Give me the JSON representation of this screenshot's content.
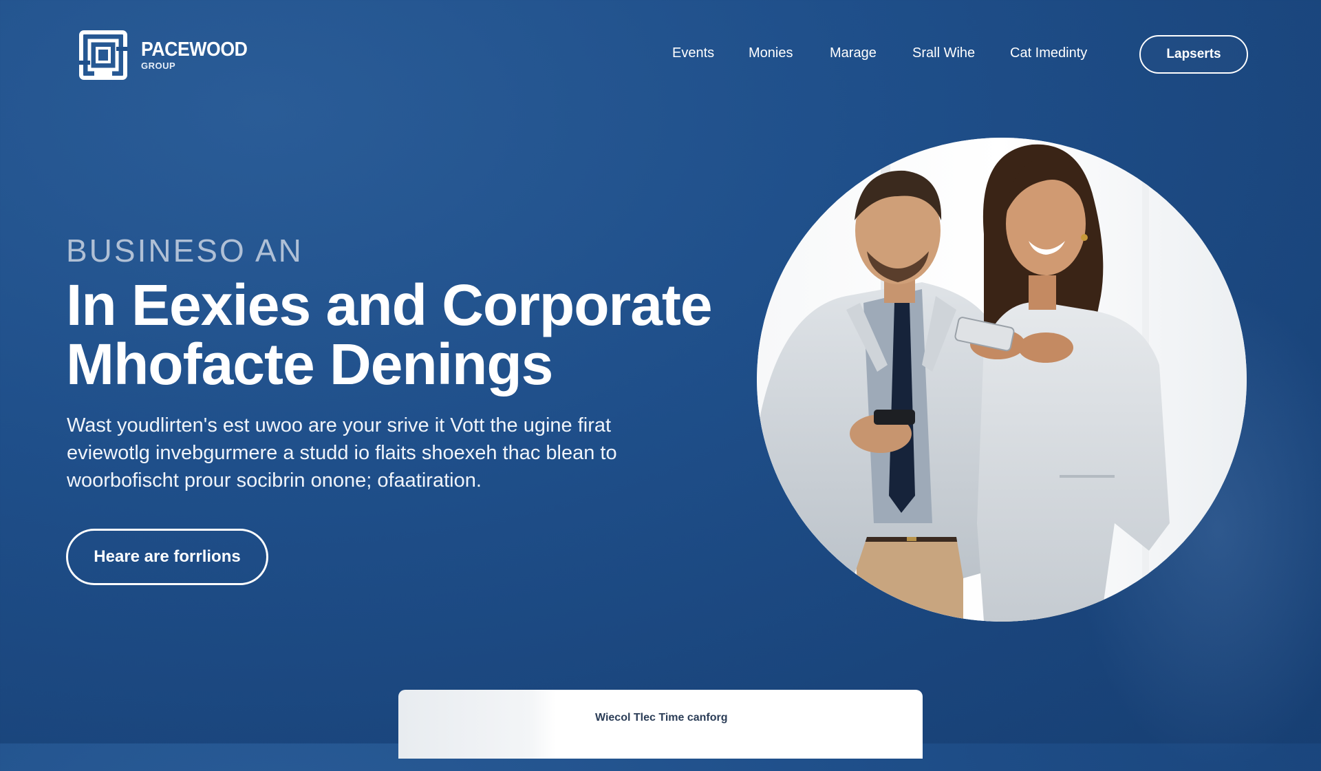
{
  "brand": {
    "name": "PACEWOOD",
    "sub": "GROUP"
  },
  "nav": {
    "items": [
      {
        "label": "Events"
      },
      {
        "label": "Monies"
      },
      {
        "label": "Marage"
      },
      {
        "label": "Srall Wihe"
      },
      {
        "label": "Cat Imedinty"
      }
    ],
    "cta_label": "Lapserts"
  },
  "hero": {
    "eyebrow": "BUSINESO AN",
    "headline_line1": "In Eexies and Corporate",
    "headline_line2": "Mhofacte Denings",
    "lede_line1": "Wast youdlirten's est uwoo are your srive it Vott the ugine firat",
    "lede_line2": "eviewotlg invebgurmere a studd io flaits shoexeh thac blean to",
    "lede_line3": "woorbofischt prour socibrin onone; ofaatiration.",
    "cta_label": "Heare are forrlions"
  },
  "bottom_card": {
    "text": "Wiecol Tlec Time canforg"
  },
  "colors": {
    "background": "#1f4f8a",
    "accent": "#ffffff"
  },
  "icons": {
    "logo": "square-maze-logo-icon"
  }
}
